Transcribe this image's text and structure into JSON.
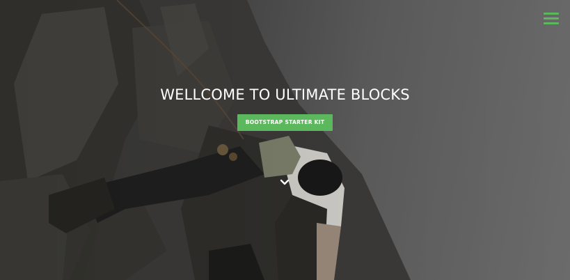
{
  "theme": {
    "accent": "#5cb85c",
    "text": "#ffffff"
  },
  "header": {
    "menu_icon": "hamburger-menu-icon"
  },
  "hero": {
    "title": "WELLCOME TO ULTIMATE BLOCKS",
    "cta_label": "BOOTSTRAP STARTER KIT",
    "scroll_icon": "chevron-down-icon"
  }
}
